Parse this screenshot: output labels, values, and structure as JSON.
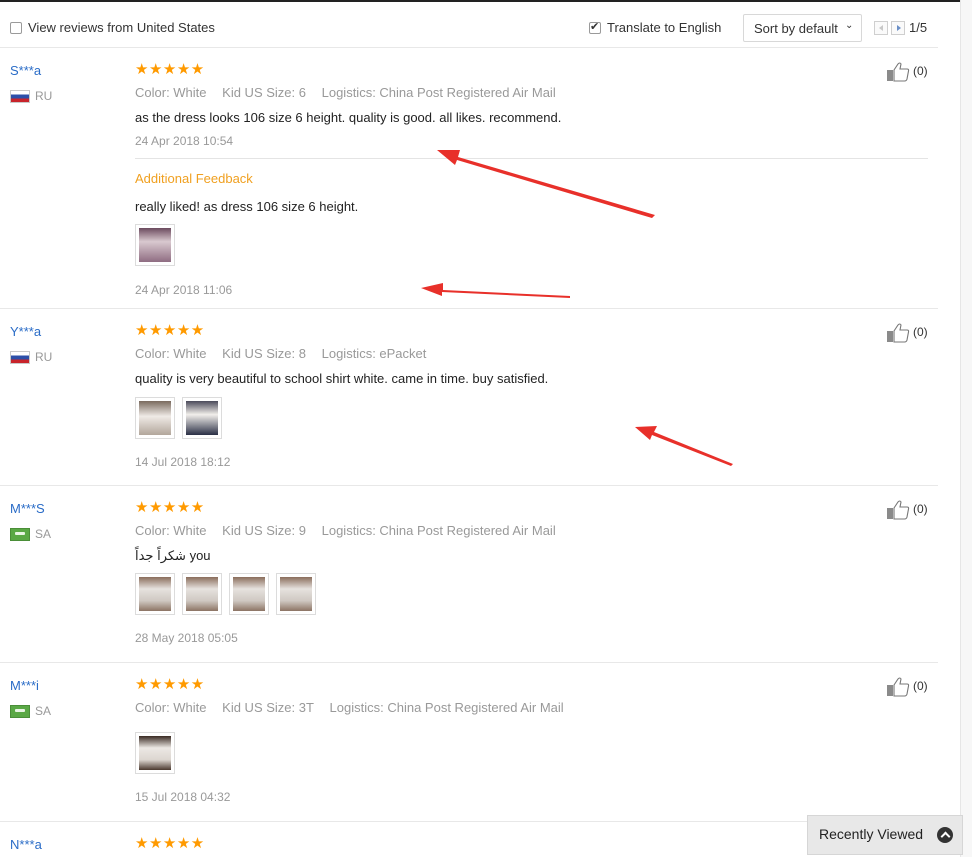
{
  "toolbar": {
    "view_us_label": "View reviews from United States",
    "translate_label": "Translate to English",
    "sort_label": "Sort by default",
    "page_indicator": "1/5"
  },
  "reviews": [
    {
      "user": "S***a",
      "country": "RU",
      "stars": "★★★★★",
      "color": "Color: White",
      "size": "Kid US Size: 6",
      "logistics": "Logistics: China Post Registered Air Mail",
      "text": "as the dress looks 106 size 6 height. quality is good. all likes. recommend.",
      "date": "24 Apr 2018 10:54",
      "additional_label": "Additional Feedback",
      "additional_text": "really liked! as dress 106 size 6 height.",
      "additional_date": "24 Apr 2018 11:06",
      "likes": "(0)"
    },
    {
      "user": "Y***a",
      "country": "RU",
      "stars": "★★★★★",
      "color": "Color: White",
      "size": "Kid US Size: 8",
      "logistics": "Logistics: ePacket",
      "text": "quality is very beautiful to school shirt white. came in time. buy satisfied.",
      "date": "14 Jul 2018 18:12",
      "likes": "(0)"
    },
    {
      "user": "M***S",
      "country": "SA",
      "stars": "★★★★★",
      "color": "Color: White",
      "size": "Kid US Size: 9",
      "logistics": "Logistics: China Post Registered Air Mail",
      "text": "شكراً جداً you",
      "date": "28 May 2018 05:05",
      "likes": "(0)"
    },
    {
      "user": "M***i",
      "country": "SA",
      "stars": "★★★★★",
      "color": "Color: White",
      "size": "Kid US Size: 3T",
      "logistics": "Logistics: China Post Registered Air Mail",
      "date": "15 Jul 2018 04:32",
      "likes": "(0)"
    },
    {
      "user": "N***a",
      "stars": "★★★★★"
    }
  ],
  "recently_viewed": "Recently Viewed",
  "colors": {
    "username": "#2a6cc7",
    "stars": "#ff9a00",
    "additional_feedback": "#f0a020",
    "annotation_arrow": "#e8302a"
  }
}
